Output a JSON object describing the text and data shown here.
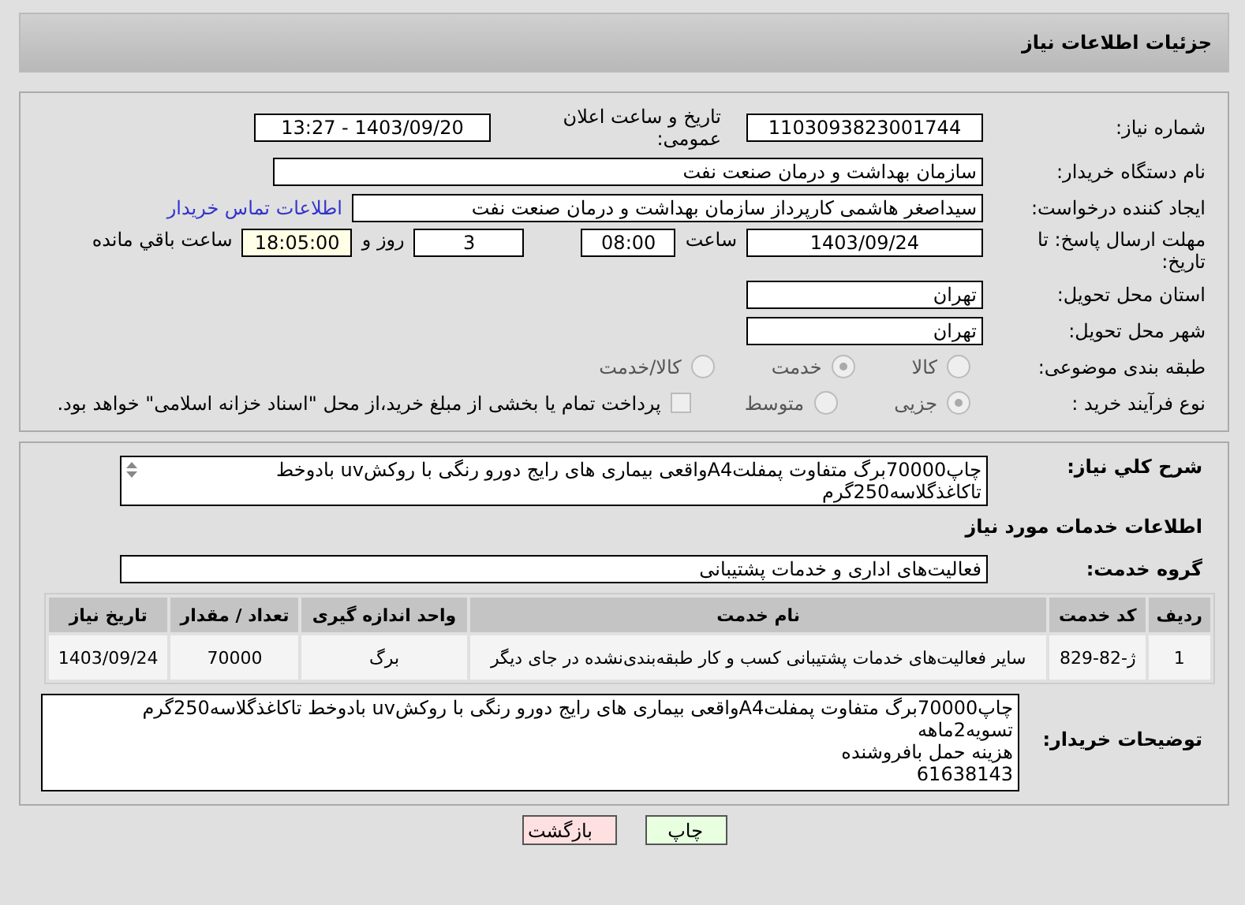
{
  "header": {
    "title": "جزئیات اطلاعات نیاز"
  },
  "need_number": {
    "label": "شماره نیاز:",
    "value": "1103093823001744"
  },
  "announce": {
    "label": "تاریخ و ساعت اعلان عمومی:",
    "value": "1403/09/20 - 13:27"
  },
  "buyer_org": {
    "label": "نام دستگاه خریدار:",
    "value": "سازمان بهداشت و درمان صنعت نفت"
  },
  "creator": {
    "label": "ایجاد کننده درخواست:",
    "value": "سیداصغر هاشمی کارپرداز سازمان بهداشت و درمان صنعت نفت",
    "link": "اطلاعات تماس خریدار"
  },
  "deadline": {
    "label": "مهلت ارسال پاسخ: تا تاریخ:",
    "date": "1403/09/24",
    "time_label": "ساعت",
    "time": "08:00",
    "days": "3",
    "days_label": "روز و",
    "remaining": "18:05:00",
    "remaining_label": "ساعت باقي مانده"
  },
  "province": {
    "label": "استان محل تحویل:",
    "value": "تهران"
  },
  "city": {
    "label": "شهر محل تحویل:",
    "value": "تهران"
  },
  "category": {
    "label": "طبقه بندی موضوعی:",
    "options": [
      {
        "label": "کالا",
        "selected": false
      },
      {
        "label": "خدمت",
        "selected": true
      },
      {
        "label": "کالا/خدمت",
        "selected": false
      }
    ]
  },
  "purchase_type": {
    "label": "نوع فرآیند خرید :",
    "options": [
      {
        "label": "جزیی",
        "selected": true
      },
      {
        "label": "متوسط",
        "selected": false
      }
    ],
    "payment": {
      "checked": false,
      "label": "پرداخت تمام یا بخشی از مبلغ خرید،از محل \"اسناد خزانه اسلامی\" خواهد بود."
    }
  },
  "summary": {
    "label": "شرح کلي نیاز:",
    "value": "چاپ70000برگ متفاوت پمفلتA4واقعی بیماری های رایج دورو رنگی با روکشuv بادوخط تاکاغذگلاسه250گرم"
  },
  "services_heading": "اطلاعات خدمات مورد نیاز",
  "service_group": {
    "label": "گروه خدمت:",
    "value": "فعالیت‌های اداری و خدمات پشتیبانی"
  },
  "table": {
    "columns": [
      "ردیف",
      "کد خدمت",
      "نام خدمت",
      "واحد اندازه گیری",
      "تعداد / مقدار",
      "تاریخ نیاز"
    ],
    "rows": [
      [
        "1",
        "ژ-82-829",
        "سایر فعالیت‌های خدمات پشتیبانی کسب و کار طبقه‌بندی‌نشده در جای دیگر",
        "برگ",
        "70000",
        "1403/09/24"
      ]
    ]
  },
  "buyer_notes": {
    "label": "توضیحات خریدار:",
    "lines": [
      "چاپ70000برگ متفاوت پمفلتA4واقعی بیماری های رایج دورو رنگی با روکشuv بادوخط تاکاغذگلاسه250گرم",
      "تسویه2ماهه",
      "هزینه حمل بافروشنده",
      "61638143"
    ]
  },
  "buttons": [
    {
      "label": "چاپ",
      "kind": "print"
    },
    {
      "label": "بازگشت",
      "kind": "back"
    }
  ]
}
